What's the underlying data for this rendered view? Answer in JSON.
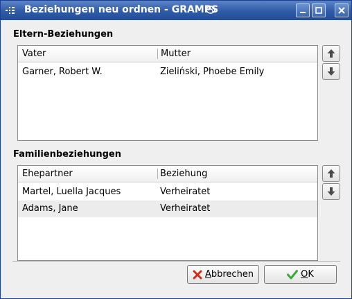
{
  "window": {
    "title": "Beziehungen neu ordnen - GRAMPS",
    "menu_icon": "window-menu-icon",
    "controls": [
      "minimize-icon",
      "maximize-icon",
      "close-icon"
    ]
  },
  "parents": {
    "section_label": "Eltern-Beziehungen",
    "columns": [
      "Vater",
      "Mutter"
    ],
    "rows": [
      [
        "Garner, Robert W.",
        "Zieliński, Phoebe Emily"
      ]
    ]
  },
  "families": {
    "section_label": "Familienbeziehungen",
    "columns": [
      "Ehepartner",
      "Beziehung"
    ],
    "rows": [
      [
        "Martel, Luella Jacques",
        "Verheiratet"
      ],
      [
        "Adams, Jane",
        "Verheiratet"
      ]
    ]
  },
  "buttons": {
    "cancel_label": "Abbrechen",
    "ok_label": "OK"
  },
  "icons": {
    "up": "arrow-up-icon",
    "down": "arrow-down-icon",
    "cancel": "red-x-icon",
    "ok": "green-check-icon"
  },
  "colors": {
    "titlebar": "#2f5aa6",
    "cancel_icon": "#d42a1a",
    "ok_icon": "#3aa83a"
  }
}
